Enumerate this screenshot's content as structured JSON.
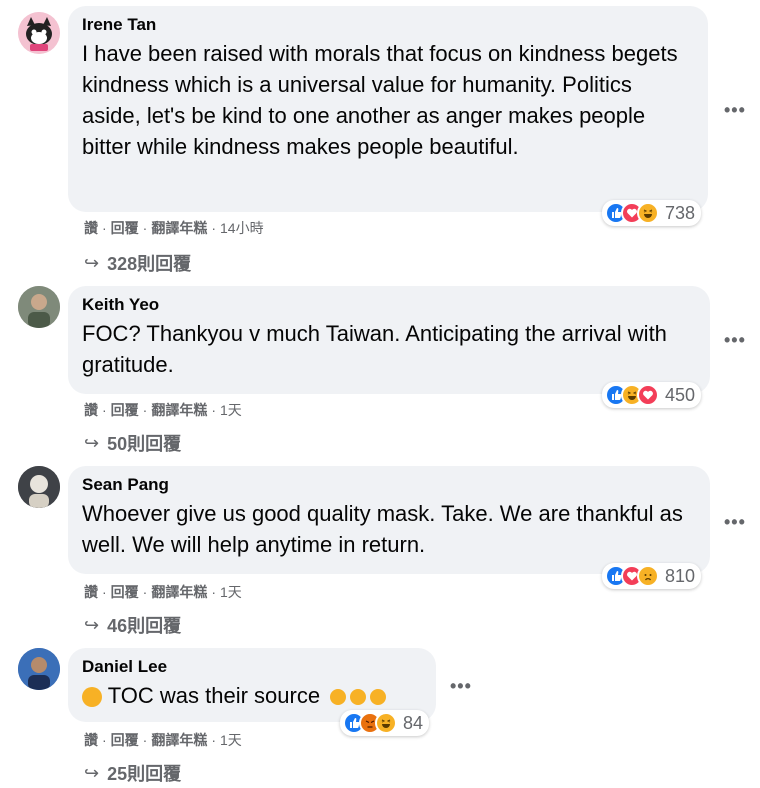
{
  "colors": {
    "bubble_bg": "#f0f2f5",
    "meta_text": "#65676b",
    "like_blue": "#1877f2",
    "love_red": "#f33e58",
    "haha_yellow": "#f7b125",
    "angry_orange": "#e9710f"
  },
  "comments": [
    {
      "author": "Irene Tan",
      "text": "I have been raised with morals that focus on kindness begets kindness which is a universal value for humanity. Politics aside, let's be kind to one another as anger makes people bitter while kindness makes people beautiful.",
      "reaction_icons": [
        "like-icon",
        "love-icon",
        "haha-icon"
      ],
      "reaction_count": "738",
      "actions": {
        "like": "讚",
        "reply": "回覆",
        "translate": "翻譯年糕",
        "time": "14小時"
      },
      "replies_label": "328則回覆"
    },
    {
      "author": "Keith Yeo",
      "text": "FOC? Thankyou v much Taiwan. Anticipating the arrival with gratitude.",
      "reaction_icons": [
        "like-icon",
        "haha-icon",
        "love-icon"
      ],
      "reaction_count": "450",
      "actions": {
        "like": "讚",
        "reply": "回覆",
        "translate": "翻譯年糕",
        "time": "1天"
      },
      "replies_label": "50則回覆"
    },
    {
      "author": "Sean Pang",
      "text": "Whoever give us good quality mask. Take. We are thankful as well. We will help anytime in return.",
      "reaction_icons": [
        "like-icon",
        "love-icon",
        "sad-icon"
      ],
      "reaction_count": "810",
      "actions": {
        "like": "讚",
        "reply": "回覆",
        "translate": "翻譯年糕",
        "time": "1天"
      },
      "replies_label": "46則回覆"
    },
    {
      "author": "Daniel Lee",
      "text": "TOC was their source",
      "reaction_icons": [
        "like-icon",
        "angry-icon",
        "haha-icon"
      ],
      "reaction_count": "84",
      "actions": {
        "like": "讚",
        "reply": "回覆",
        "translate": "翻譯年糕",
        "time": "1天"
      },
      "replies_label": "25則回覆"
    }
  ],
  "more_label": "•••",
  "reply_arrow": "↪"
}
